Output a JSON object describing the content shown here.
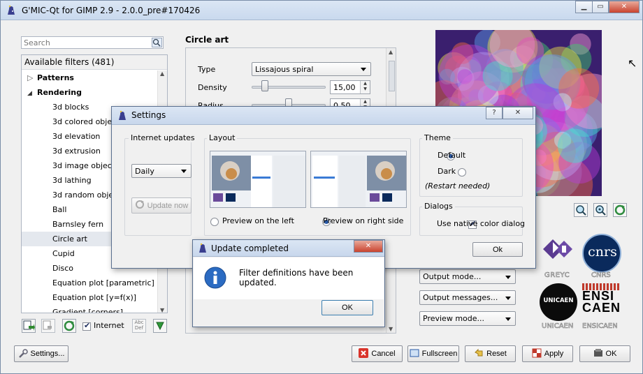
{
  "window": {
    "title": "G'MIC-Qt for GIMP 2.9   - 2.0.0_pre#170426",
    "controls": [
      "minimize",
      "maximize",
      "close"
    ]
  },
  "left_panel": {
    "search_placeholder": "Search",
    "tree_header": "Available filters (481)",
    "categories": [
      {
        "label": "Patterns",
        "expanded": false
      },
      {
        "label": "Rendering",
        "expanded": true
      }
    ],
    "filters": [
      "3d blocks",
      "3d colored object",
      "3d elevation",
      "3d extrusion",
      "3d image object",
      "3d lathing",
      "3d random object",
      "Ball",
      "Barnsley fern",
      "Circle art",
      "Cupid",
      "Disco",
      "Equation plot [parametric]",
      "Equation plot [y=f(x)]",
      "Gradient [corners]"
    ],
    "selected_filter": "Circle art",
    "internet_label": "Internet",
    "internet_checked": true,
    "settings_button": "Settings..."
  },
  "filter_panel": {
    "title": "Circle art",
    "params": {
      "type_label": "Type",
      "type_value": "Lissajous spiral",
      "density_label": "Density",
      "density_value": "15,00",
      "radius_label": "Radius",
      "radius_value": "0,50"
    },
    "output_mode": "Output mode...",
    "output_messages": "Output messages...",
    "preview_mode": "Preview mode..."
  },
  "bottom_buttons": {
    "cancel": "Cancel",
    "fullscreen": "Fullscreen",
    "reset": "Reset",
    "apply": "Apply",
    "ok": "OK"
  },
  "logos": {
    "greyc": "GREYC",
    "cnrs": "CNRS",
    "cnrs_mark": "cnrs",
    "unicaen": "UNICAEN",
    "unicaen_mark": "UNICAEN",
    "ensicaen": "ENSICAEN",
    "ensicaen_mark_1": "ENSI",
    "ensicaen_mark_2": "CAEN"
  },
  "settings_dialog": {
    "title": "Settings",
    "internet_updates": {
      "title": "Internet updates",
      "frequency": "Daily",
      "update_now": "Update now",
      "update_now_enabled": false
    },
    "layout": {
      "title": "Layout",
      "preview_left": "Preview on the left",
      "preview_right": "Preview on right side",
      "selected": "right"
    },
    "theme": {
      "title": "Theme",
      "default_label": "Default",
      "dark_label": "Dark",
      "restart_note": "(Restart needed)",
      "selected": "default"
    },
    "dialogs": {
      "title": "Dialogs",
      "native_color_label": "Use native color dialog",
      "native_color_checked": true
    },
    "ok": "Ok"
  },
  "update_dialog": {
    "title": "Update completed",
    "message": "Filter definitions have been updated.",
    "ok": "OK"
  },
  "colors": {
    "title_bar": "#c9d9ee",
    "selection": "#e4e8ee",
    "accent": "#2a5aa8"
  }
}
